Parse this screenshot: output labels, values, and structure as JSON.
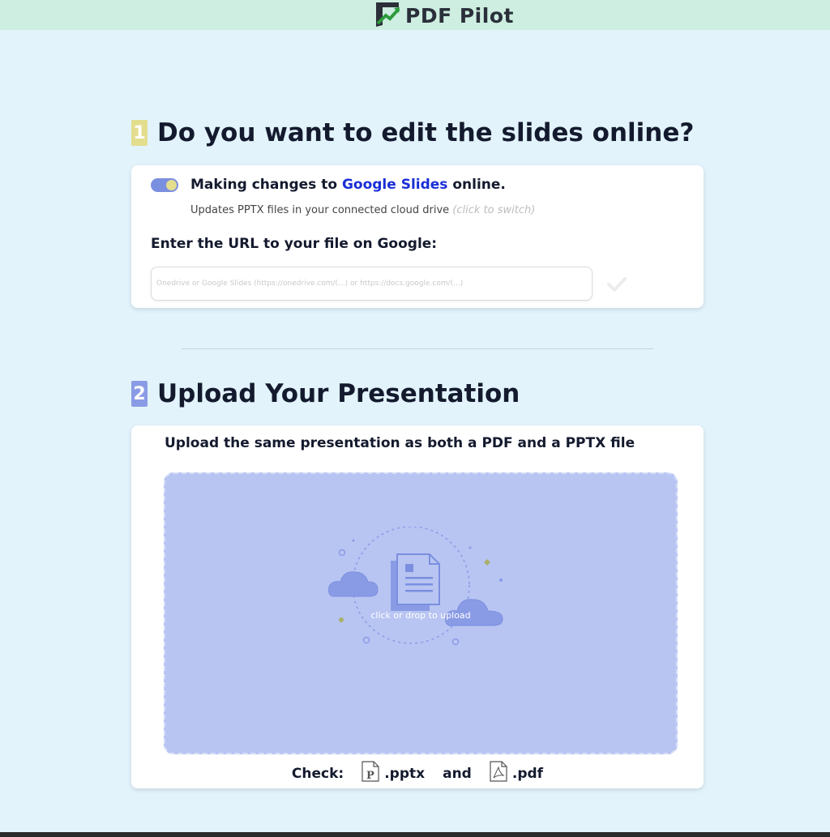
{
  "header": {
    "logo_text": "PDF Pilot",
    "brand_color": "#2d7a3e"
  },
  "step1": {
    "number": "1",
    "badge_color": "#e3dd8e",
    "title": "Do you want to edit the slides online?",
    "toggle": {
      "state": "on",
      "prefix": "Making changes to",
      "link": "Google Slides",
      "suffix": "online."
    },
    "description": "Updates PPTX files in your connected cloud drive",
    "hint": "(click to switch)",
    "url_label": "Enter the URL to your file on Google:",
    "url_value": "",
    "url_placeholder": "Onedrive or Google Slides (https://onedrive.com/(...) or https://docs.google.com/(...)"
  },
  "step2": {
    "number": "2",
    "badge_color": "#8a9be6",
    "title": "Upload Your Presentation",
    "heading": "Upload the same presentation as both a PDF and a PPTX file",
    "dropzone_text": "click or drop to upload",
    "check_label": "Check:",
    "ext1": ".pptx",
    "and_label": "and",
    "ext2": ".pdf"
  },
  "icons": [
    "logo-icon",
    "toggle-switch",
    "checkmark-icon",
    "cloud-icon",
    "document-icon",
    "pptx-file-icon",
    "pdf-file-icon"
  ],
  "colors": {
    "background": "#e2f3fb",
    "topbar": "#cdeee0",
    "link": "#1a2fd6",
    "dropzone": "#b8c5f2",
    "toggle": "#7b8fe0"
  }
}
